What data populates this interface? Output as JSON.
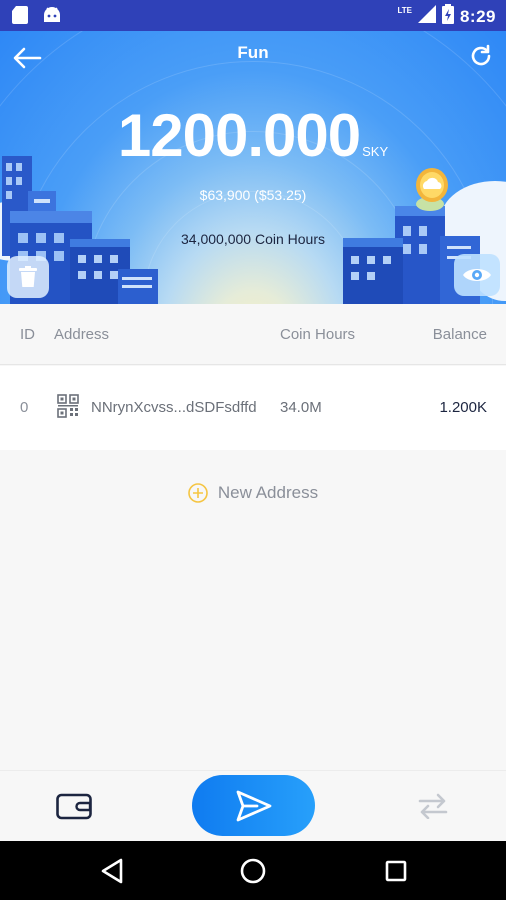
{
  "status_bar": {
    "time": "8:29",
    "network": "LTE",
    "battery_icon": "battery-charging-icon",
    "left_icons": [
      "sd-card-icon",
      "android-icon"
    ]
  },
  "header": {
    "title": "Fun",
    "balance": "1200.000",
    "unit": "SKY",
    "fiat": "$63,900 ($53.25)",
    "coin_hours": "34,000,000 Coin Hours",
    "gradient_top": "#2e88f6",
    "gradient_center": "#f7f0c2"
  },
  "table": {
    "headers": {
      "id": "ID",
      "address": "Address",
      "coin_hours": "Coin Hours",
      "balance": "Balance"
    },
    "rows": [
      {
        "id": "0",
        "address": "NNrynXcvss...dSDFsdffd",
        "coin_hours": "34.0M",
        "balance": "1.200K"
      }
    ]
  },
  "new_address": {
    "label": "New Address",
    "icon": "plus-circle-icon",
    "color": "#f5c542"
  },
  "bottom_bar": {
    "wallet_icon": "wallet-icon",
    "send_icon": "send-icon",
    "transfer_icon": "transfer-icon",
    "send_gradient": [
      "#0f7bf0",
      "#27a0fb"
    ]
  },
  "nav_bar": {
    "icons": [
      "nav-back-icon",
      "nav-home-icon",
      "nav-recents-icon"
    ]
  }
}
